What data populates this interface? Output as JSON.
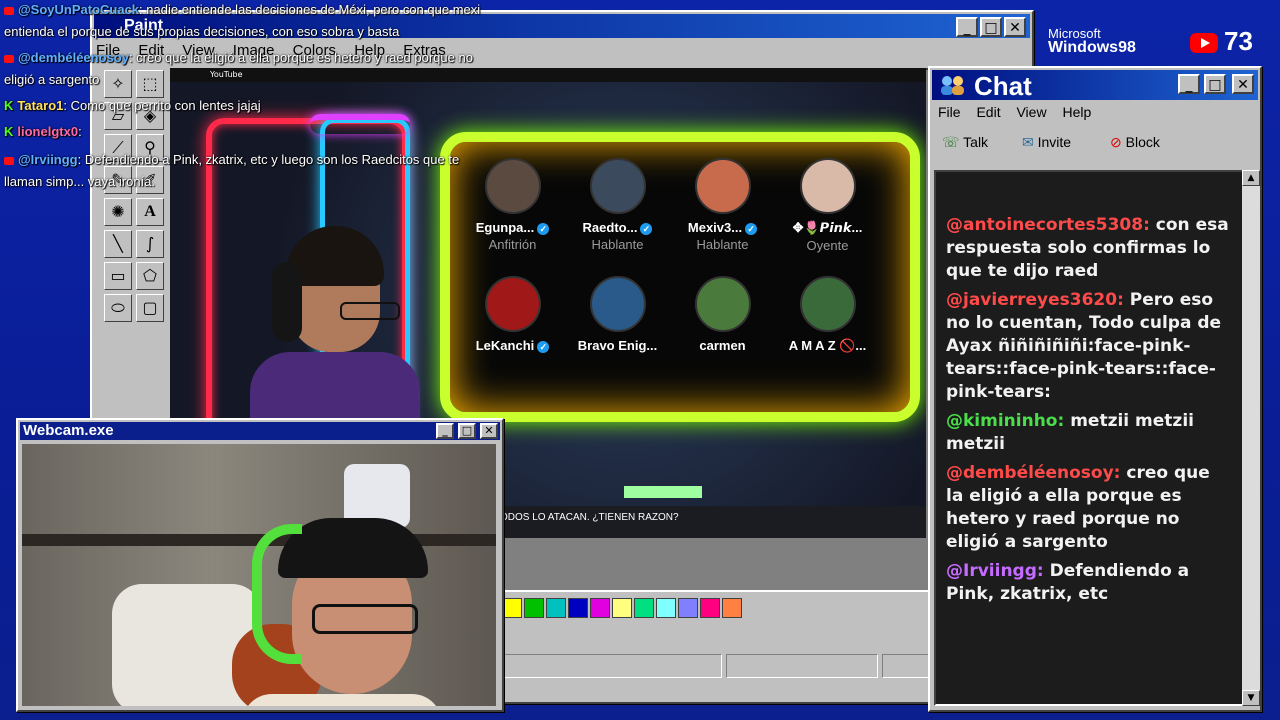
{
  "paint": {
    "title": "Paint",
    "menu": [
      "File",
      "Edit",
      "View",
      "Image",
      "Colors",
      "Help",
      "Extras"
    ],
    "palette": [
      "#ffff00",
      "#00c000",
      "#00c0c0",
      "#0000c0",
      "#e000e0",
      "#ffff80",
      "#00e080",
      "#80ffff",
      "#8080ff",
      "#ff0080",
      "#ff8040"
    ]
  },
  "youtube": {
    "logo": "YouTube",
    "caption": "ODOS LO ATACAN. ¿TIENEN RAZON?",
    "speakers": [
      {
        "name": "Egunpa...",
        "role": "Anfitrión",
        "avatar": "#5a4a40",
        "verified": true
      },
      {
        "name": "Raedto...",
        "role": "Hablante",
        "avatar": "#3b4a5c",
        "verified": true
      },
      {
        "name": "Mexiv3...",
        "role": "Hablante",
        "avatar": "#c86a4c",
        "verified": true
      },
      {
        "name": "✥🌷𝙋𝙞𝙣𝙠...",
        "role": "Oyente",
        "avatar": "#d9b9a8",
        "verified": false
      },
      {
        "name": "LeKanchi",
        "role": "",
        "avatar": "#a01818",
        "verified": true
      },
      {
        "name": "Bravo Enig...",
        "role": "",
        "avatar": "#2a5a8a",
        "verified": false
      },
      {
        "name": "carmen",
        "role": "",
        "avatar": "#4a7a3c",
        "verified": false
      },
      {
        "name": "A M A Z 🚫...",
        "role": "",
        "avatar": "#3a6a3a",
        "verified": false
      }
    ]
  },
  "chat": {
    "title": "Chat",
    "menu": [
      "File",
      "Edit",
      "View",
      "Help"
    ],
    "tools": {
      "talk": "Talk",
      "invite": "Invite",
      "block": "Block"
    },
    "messages": [
      {
        "user": "@antoinecortes5308:",
        "text": "con esa respuesta solo confirmas lo que te dijo raed",
        "color": "#ff4a4a"
      },
      {
        "user": "@javierreyes3620:",
        "text": "Pero eso no lo cuentan, Todo culpa de Ayax ñiñiñiñiñi:face-pink-tears::face-pink-tears::face-pink-tears:",
        "color": "#ff4a4a"
      },
      {
        "user": "@kimininho:",
        "text": "metzii metzii metzii",
        "color": "#4ade4a"
      },
      {
        "user": "@dembéléenosoy:",
        "text": "creo que la eligió a ella porque es hetero y raed porque no eligió a sargento",
        "color": "#ff4a4a"
      },
      {
        "user": "@Irviingg:",
        "text": "Defendiendo a Pink, zkatrix, etc",
        "color": "#c56bff"
      }
    ]
  },
  "webcam": {
    "title": "Webcam.exe"
  },
  "overlay": [
    {
      "platform": "yt",
      "user": "@SoyUnPatoCuack",
      "text": ": nadie entiende las decisiones de Méxi, pero con que mexi"
    },
    {
      "platform": "none",
      "user": "",
      "text": "entienda el porque de sus propias decisiones, con eso sobra y basta"
    },
    {
      "platform": "yt",
      "user": "@dembéléenosoy",
      "text": ": creo que la eligió a ella porque es hetero y raed porque no"
    },
    {
      "platform": "none",
      "user": "",
      "text": "eligió a sargento"
    },
    {
      "platform": "kick",
      "user": "Tataro1",
      "text": ": Como que perrito con lentes jajaj"
    },
    {
      "platform": "kick",
      "user": "lionelgtx0",
      "text": ":"
    },
    {
      "platform": "yt",
      "user": "@Irviingg",
      "text": ": Defendiendo a Pink, zkatrix, etc y luego son los Raedcitos que te"
    },
    {
      "platform": "none",
      "user": "",
      "text": "llaman simp... vaya ironía."
    }
  ],
  "branding": {
    "microsoft": "Microsoft",
    "windows": "Windows98",
    "viewers": "73"
  }
}
